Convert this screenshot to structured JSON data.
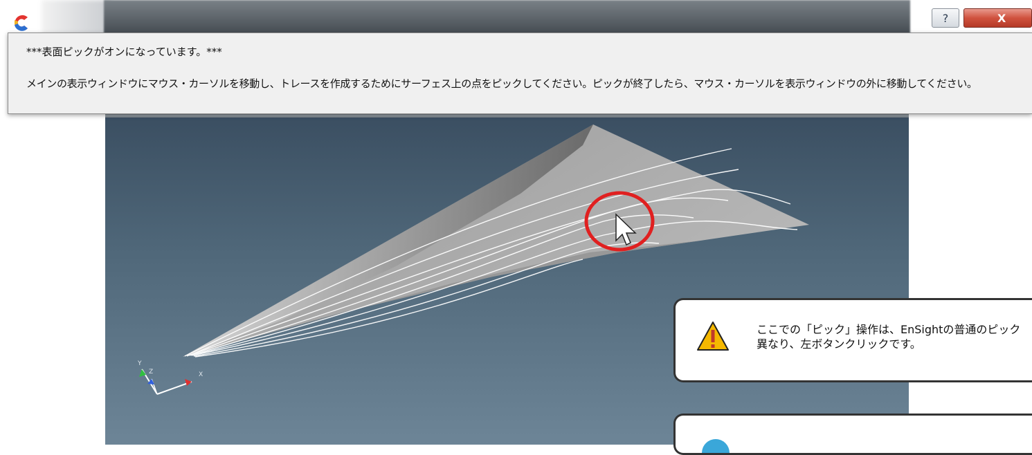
{
  "window": {
    "help_label": "?",
    "close_label": "X"
  },
  "message": {
    "line1": "***表面ピックがオンになっています。***",
    "line2": "メインの表示ウィンドウにマウス・カーソルを移動し、トレースを作成するためにサーフェス上の点をピックしてください。ピックが終了したら、マウス・カーソルを表示ウィンドウの外に移動してください。"
  },
  "viewport": {
    "axis_labels": {
      "x": "X",
      "y": "Y",
      "z": "Z"
    },
    "colors": {
      "background_top": "#3b4f62",
      "background_bottom": "#6d8597",
      "surface": "#a9a9a9",
      "highlight_circle": "#e02020"
    }
  },
  "callouts": {
    "warning": {
      "icon": "warning-triangle-icon",
      "line1": "ここでの「ピック」操作は、EnSightの普通のピック",
      "line2": "異なり、左ボタンクリックです。"
    },
    "info": {
      "icon": "info-icon"
    }
  }
}
